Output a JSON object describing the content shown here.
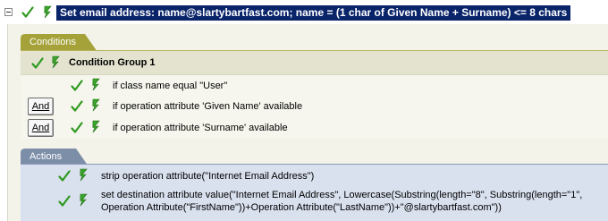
{
  "rule": {
    "title": "Set email address: name@slartybartfast.com; name = (1 char of Given Name + Surname) <= 8 chars"
  },
  "conditions": {
    "tab_label": "Conditions",
    "group_label": "Condition Group 1",
    "items": [
      {
        "text": "if class name equal \"User\""
      },
      {
        "and_label": "And",
        "text": "if operation attribute 'Given Name' available"
      },
      {
        "and_label": "And",
        "text": "if operation attribute 'Surname' available"
      }
    ]
  },
  "actions": {
    "tab_label": "Actions",
    "items": [
      {
        "text": "strip operation attribute(\"Internet Email Address\")"
      },
      {
        "line1": "set destination attribute value(\"Internet Email Address\", Lowercase(Substring(length=\"8\", Substring(length=\"1\",",
        "line2": "Operation Attribute(\"FirstName\"))+Operation Attribute(\"LastName\"))+\"@slartybartfast.com\"))"
      }
    ]
  },
  "colors": {
    "selection": "#0a246a",
    "conditions_accent": "#a5a23a",
    "actions_accent": "#7d8ea8",
    "check": "#2f9a1f"
  },
  "icons": [
    "collapse-icon",
    "check-icon",
    "bolt-icon"
  ]
}
